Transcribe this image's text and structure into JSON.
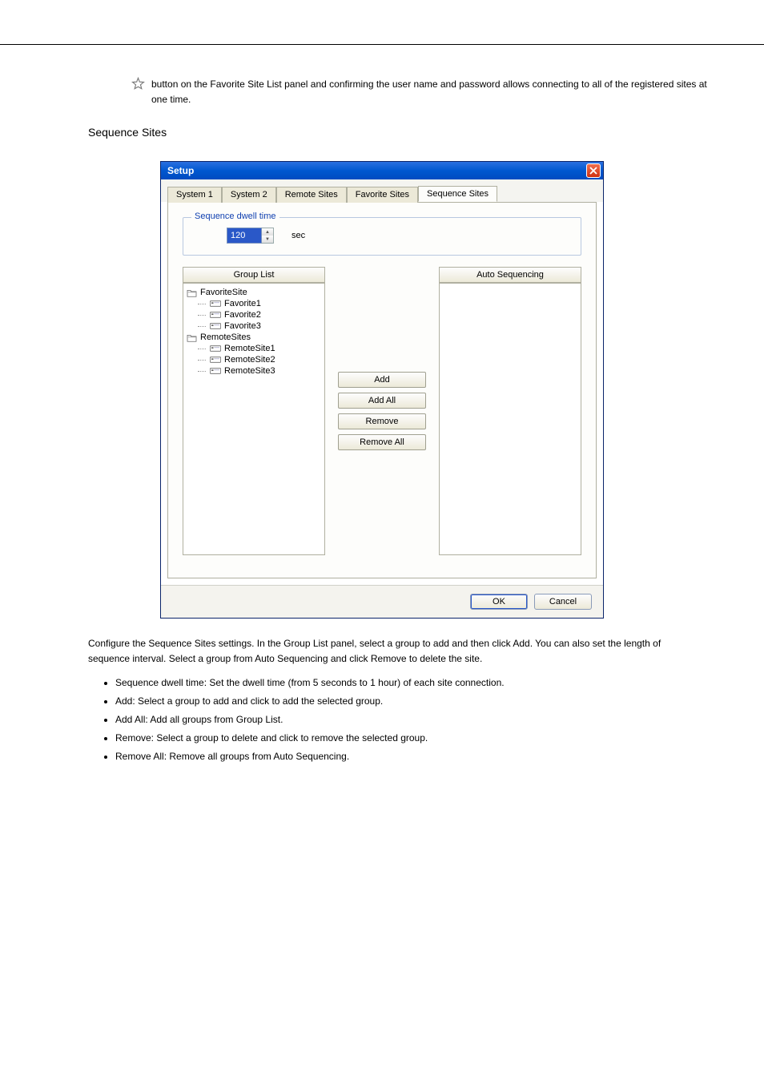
{
  "intro": {
    "line": "button on the Favorite Site List panel and confirming the user name and password allows connecting to all of the registered sites at one time."
  },
  "section_title": "Sequence Sites",
  "window": {
    "title": "Setup",
    "tabs": [
      "System 1",
      "System 2",
      "Remote Sites",
      "Favorite Sites",
      "Sequence Sites"
    ],
    "active_tab": "Sequence Sites",
    "dwell_legend": "Sequence dwell time",
    "dwell_value": "120",
    "dwell_unit": "sec",
    "group_list_header": "Group List",
    "auto_seq_header": "Auto Sequencing",
    "tree": {
      "group1": "FavoriteSite",
      "group1_items": [
        "Favorite1",
        "Favorite2",
        "Favorite3"
      ],
      "group2": "RemoteSites",
      "group2_items": [
        "RemoteSite1",
        "RemoteSite2",
        "RemoteSite3"
      ]
    },
    "mid_buttons": {
      "add": "Add",
      "add_all": "Add All",
      "remove": "Remove",
      "remove_all": "Remove All"
    },
    "ok": "OK",
    "cancel": "Cancel"
  },
  "desc": "Configure the Sequence Sites settings. In the Group List panel, select a group to add and then click Add. You can also set the length of sequence interval. Select a group from Auto Sequencing and click Remove to delete the site.",
  "bullets": [
    "Sequence dwell time: Set the dwell time (from 5 seconds to 1 hour) of each site connection.",
    "Add: Select a group to add and click to add the selected group.",
    "Add All: Add all groups from Group List.",
    "Remove: Select a group to delete and click to remove the selected group.",
    "Remove All: Remove all groups from Auto Sequencing."
  ]
}
